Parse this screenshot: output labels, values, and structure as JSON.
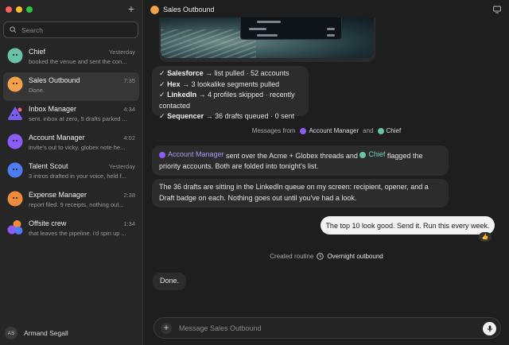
{
  "sidebar": {
    "compose_icon": "plus-icon",
    "search_placeholder": "Search",
    "conversations": [
      {
        "name": "Chief",
        "time": "Yesterday",
        "preview": "booked the venue and sent the con...",
        "color": "#67c2a6",
        "active": false
      },
      {
        "name": "Sales Outbound",
        "time": "7:35",
        "preview": "Done.",
        "color": "#f2a049",
        "active": true
      },
      {
        "name": "Inbox Manager",
        "time": "4:34",
        "preview": "sent. inbox at zero, 5 drafts parked ...",
        "color": "#7b5cf0",
        "active": false
      },
      {
        "name": "Account Manager",
        "time": "4:02",
        "preview": "invite's out to vicky. globex note he...",
        "color": "#8b5cf6",
        "active": false
      },
      {
        "name": "Talent Scout",
        "time": "Yesterday",
        "preview": "3 intros drafted in your voice, held f...",
        "color": "#4f7cf0",
        "active": false
      },
      {
        "name": "Expense Manager",
        "time": "2:38",
        "preview": "report filed. 9 receipts, nothing out...",
        "color": "#f08a3c",
        "active": false
      },
      {
        "name": "Offsite crew",
        "time": "1:34",
        "preview": "that leaves the pipeline. i'd spin up ...",
        "color": "#8b5cf6",
        "active": false
      }
    ],
    "user": {
      "initials": "AS",
      "name": "Armand Segall"
    }
  },
  "header": {
    "title": "Sales Outbound",
    "avatar_color": "#f2a049",
    "screen_icon": "monitor-icon"
  },
  "chat": {
    "summary_lines": [
      {
        "check": "✓",
        "bold": "Salesforce",
        "rest": " → list pulled · 52 accounts"
      },
      {
        "check": "✓",
        "bold": "Hex",
        "rest": " → 3 lookalike segments pulled"
      },
      {
        "check": "✓",
        "bold": "LinkedIn",
        "rest": " → 4 profiles skipped · recently contacted"
      },
      {
        "check": "✓",
        "bold": "Sequencer",
        "rest": " → 36 drafts queued · 0 sent"
      }
    ],
    "messages_from": {
      "prefix": "Messages from",
      "first": "Account Manager",
      "joiner": "and",
      "second": "Chief"
    },
    "msg1": {
      "mention1": "Account Manager",
      "text1": " sent over the Acme + Globex threads and ",
      "mention2": "Chief",
      "text2": " flagged the priority accounts. Both are folded into tonight's list."
    },
    "msg2": "The 36 drafts are sitting in the LinkedIn queue on my screen: recipient, opener, and a Draft badge on each. Nothing goes out until you've had a look.",
    "user_msg": "The top 10 look good. Send it. Run this every week.",
    "reaction": "👍",
    "routine": {
      "prefix": "Created routine",
      "name": "Overnight outbound"
    },
    "reply": "Done."
  },
  "composer": {
    "placeholder": "Message Sales Outbound"
  },
  "colors": {
    "account_manager": "#8b5cf6",
    "chief": "#67c2a6"
  }
}
